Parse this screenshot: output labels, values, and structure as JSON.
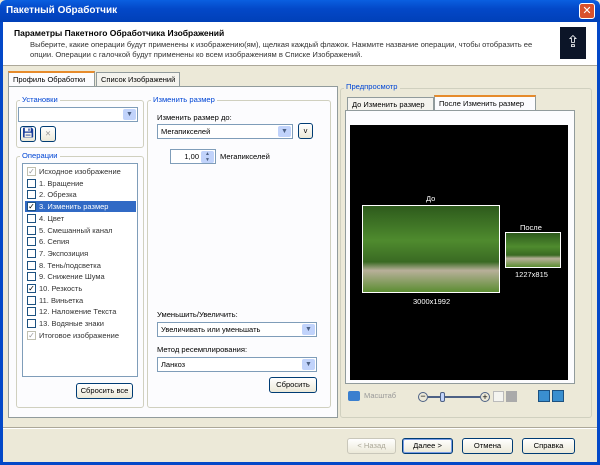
{
  "window": {
    "title": "Пакетный Обработчик",
    "close_icon": "close-icon"
  },
  "header": {
    "title": "Параметры Пакетного Обработчика Изображений",
    "description": "Выберите, какие операции будут применены к изображению(ям), щелкая каждый флажок. Нажмите название операции, чтобы отобразить ее опции. Операции с галочкой будут применены ко всем изображениям в Списке Изображений."
  },
  "tabs": [
    {
      "label": "Профиль Обработки",
      "active": true
    },
    {
      "label": "Список Изображений",
      "active": false
    }
  ],
  "presets": {
    "label": "Установки",
    "value": ""
  },
  "operations": {
    "label": "Операции",
    "items": [
      {
        "label": "Исходное изображение",
        "checked": true,
        "disabled": true
      },
      {
        "label": "1. Вращение",
        "checked": false
      },
      {
        "label": "2. Обрезка",
        "checked": false
      },
      {
        "label": "3. Изменить размер",
        "checked": true,
        "selected": true
      },
      {
        "label": "4. Цвет",
        "checked": false
      },
      {
        "label": "5. Смешанный канал",
        "checked": false
      },
      {
        "label": "6. Сепия",
        "checked": false
      },
      {
        "label": "7. Экспозиция",
        "checked": false
      },
      {
        "label": "8. Тень/подсветка",
        "checked": false
      },
      {
        "label": "9. Снижение Шума",
        "checked": false
      },
      {
        "label": "10. Резкость",
        "checked": true
      },
      {
        "label": "11. Виньетка",
        "checked": false
      },
      {
        "label": "12. Наложение Текста",
        "checked": false
      },
      {
        "label": "13. Водяные знаки",
        "checked": false
      },
      {
        "label": "Итоговое изображение",
        "checked": true,
        "disabled": true
      }
    ],
    "reset_all": "Сбросить все"
  },
  "resize": {
    "label": "Изменить размер",
    "resize_to_label": "Изменить размер до:",
    "resize_to_value": "Мегапикселей",
    "v_button": "v",
    "amount": "1,00",
    "amount_unit": "Мегапикселей",
    "shrink_label": "Уменьшить/Увеличить:",
    "shrink_value": "Увеличивать или уменьшать",
    "resample_label": "Метод ресемплирования:",
    "resample_value": "Ланкоз",
    "reset": "Сбросить"
  },
  "preview": {
    "label": "Предпросмотр",
    "tabs": [
      {
        "label": "До Изменить размер",
        "active": false
      },
      {
        "label": "После Изменить размер",
        "active": true
      }
    ],
    "before_label": "До",
    "before_size": "3000x1992",
    "after_label": "После",
    "after_size": "1227x815",
    "zoom_label": "Масштаб",
    "zoom_level": 0.25
  },
  "footer": {
    "back": "< Назад",
    "next": "Далее >",
    "cancel": "Отмена",
    "help": "Справка"
  }
}
